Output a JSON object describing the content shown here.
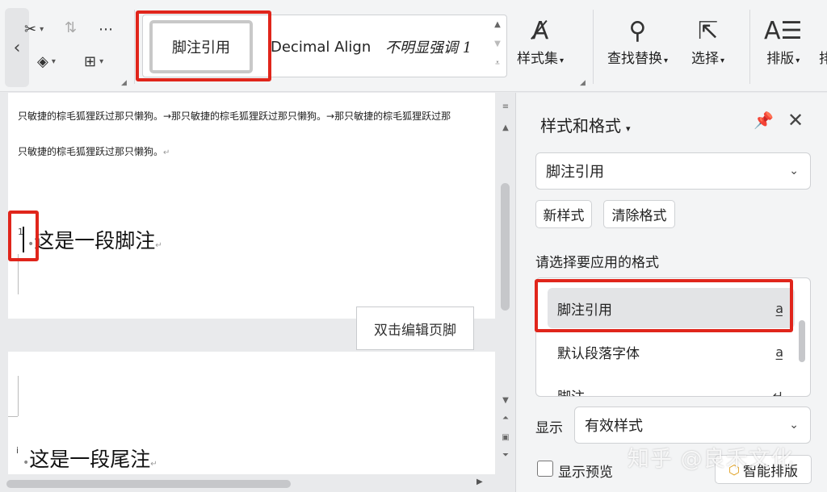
{
  "ribbon": {
    "back_icon": "chevron-left-icon",
    "gallery": {
      "selected": "脚注引用",
      "items": [
        "Decimal Align",
        "不明显强调 1"
      ]
    },
    "tools": {
      "style_set": "样式集",
      "find_replace": "查找替换",
      "select": "选择",
      "layout": "排版",
      "cut_off": "排"
    }
  },
  "document": {
    "line1": "只敏捷的棕毛狐狸跃过那只懒狗。→那只敏捷的棕毛狐狸跃过那只懒狗。→那只敏捷的棕毛狐狸跃过那",
    "line2": "只敏捷的棕毛狐狸跃过那只懒狗。",
    "footnote_mark": "1",
    "footnote_text": "这是一段脚注",
    "endnote_mark": "i",
    "endnote_text": "这是一段尾注",
    "footer_tip": "双击编辑页脚"
  },
  "panel": {
    "title": "样式和格式",
    "current_style": "脚注引用",
    "new_style": "新样式",
    "clear_format": "清除格式",
    "section_label": "请选择要应用的格式",
    "styles": [
      {
        "label": "脚注引用",
        "mark": "a̲"
      },
      {
        "label": "默认段落字体",
        "mark": "a̲"
      },
      {
        "label": "脚注",
        "mark": "↵"
      }
    ],
    "show_label": "显示",
    "show_value": "有效样式",
    "preview_label": "显示预览",
    "smart_layout": "智能排版",
    "watermark": "知乎 @良禾文化"
  },
  "colors": {
    "highlight_red": "#e0251b"
  }
}
